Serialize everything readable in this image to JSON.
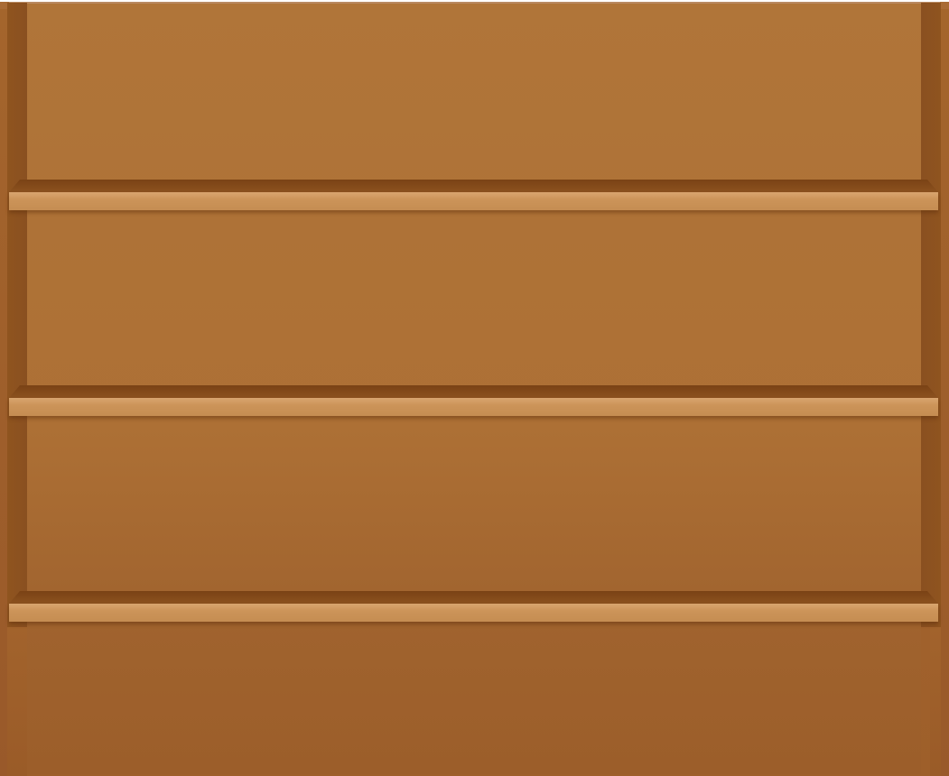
{
  "bookcase": {
    "shelf_count": 3,
    "shelves": [
      {
        "id": "shelf-1",
        "items": []
      },
      {
        "id": "shelf-2",
        "items": []
      },
      {
        "id": "shelf-3",
        "items": []
      }
    ],
    "colors": {
      "back_panel": "#b07539",
      "side_wall": "#8f541f",
      "shelf_front": "#cc9459",
      "shelf_top": "#7a4215",
      "frame": "#a96b35"
    }
  }
}
